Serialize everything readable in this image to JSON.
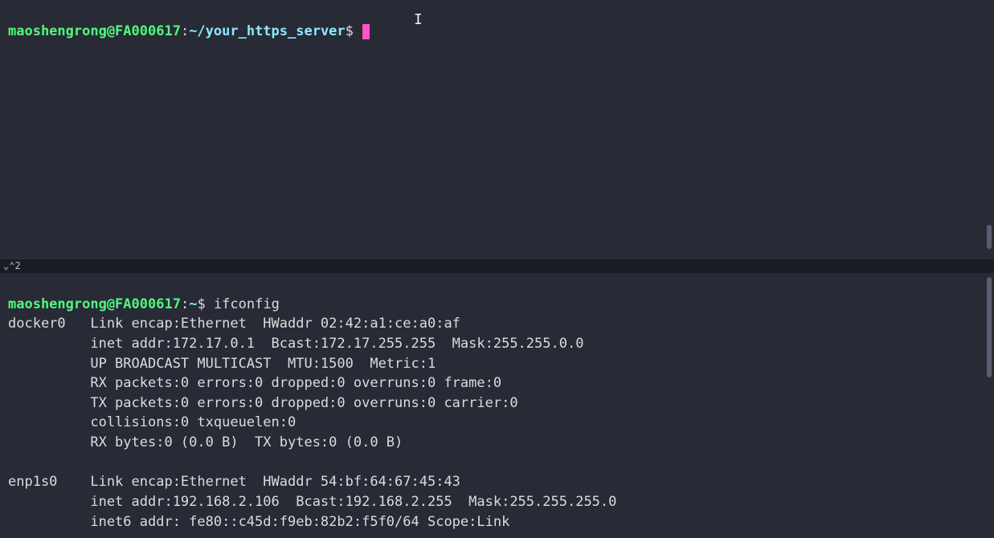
{
  "top_pane": {
    "prompt": {
      "user_host": "maoshengrong@FA000617",
      "sep": ":",
      "path": "~/your_https_server",
      "symbol": "$"
    },
    "command": ""
  },
  "split_label": "⌄⌃2",
  "bottom_pane": {
    "prompt": {
      "user_host": "maoshengrong@FA000617",
      "sep": ":",
      "path": "~",
      "symbol": "$"
    },
    "command": "ifconfig",
    "output_lines": [
      "docker0   Link encap:Ethernet  HWaddr 02:42:a1:ce:a0:af",
      "          inet addr:172.17.0.1  Bcast:172.17.255.255  Mask:255.255.0.0",
      "          UP BROADCAST MULTICAST  MTU:1500  Metric:1",
      "          RX packets:0 errors:0 dropped:0 overruns:0 frame:0",
      "          TX packets:0 errors:0 dropped:0 overruns:0 carrier:0",
      "          collisions:0 txqueuelen:0",
      "          RX bytes:0 (0.0 B)  TX bytes:0 (0.0 B)",
      "",
      "enp1s0    Link encap:Ethernet  HWaddr 54:bf:64:67:45:43",
      "          inet addr:192.168.2.106  Bcast:192.168.2.255  Mask:255.255.255.0",
      "          inet6 addr: fe80::c45d:f9eb:82b2:f5f0/64 Scope:Link"
    ]
  }
}
